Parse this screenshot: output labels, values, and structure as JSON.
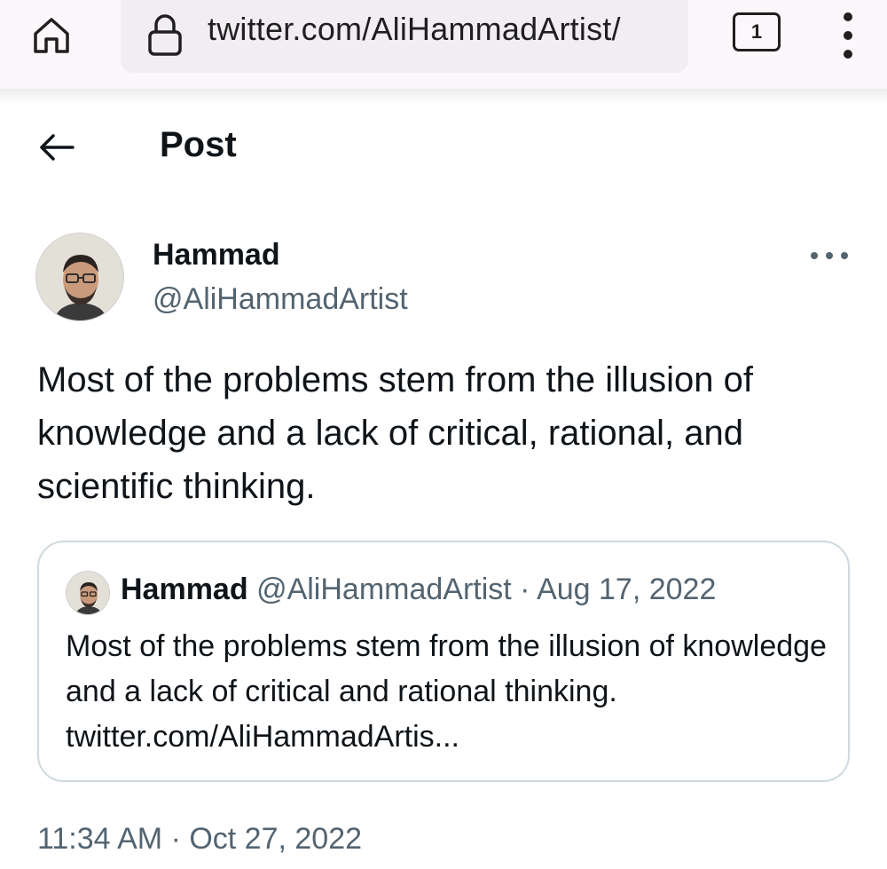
{
  "browser": {
    "url": "twitter.com/AliHammadArtist/",
    "tab_count": "1",
    "icons": [
      "home-icon",
      "lock-icon",
      "tabs-icon",
      "more-vert-icon"
    ]
  },
  "header": {
    "title": "Post"
  },
  "tweet": {
    "author_name": "Hammad",
    "author_handle": "@AliHammadArtist",
    "text": "Most of the problems stem from the illusion of knowledge and a lack of critical, rational, and scientific thinking.",
    "timestamp": "11:34 AM · Oct 27, 2022"
  },
  "quoted_tweet": {
    "author_name": "Hammad",
    "meta": "@AliHammadArtist · Aug 17, 2022",
    "text": "Most of the problems stem from the illusion of knowledge and a lack of critical and rational thinking. twitter.com/AliHammadArtis..."
  },
  "colors": {
    "text_primary": "#0f1419",
    "text_secondary": "#536471",
    "border": "#cfd9de",
    "browser_bar": "#fbf7fb"
  }
}
